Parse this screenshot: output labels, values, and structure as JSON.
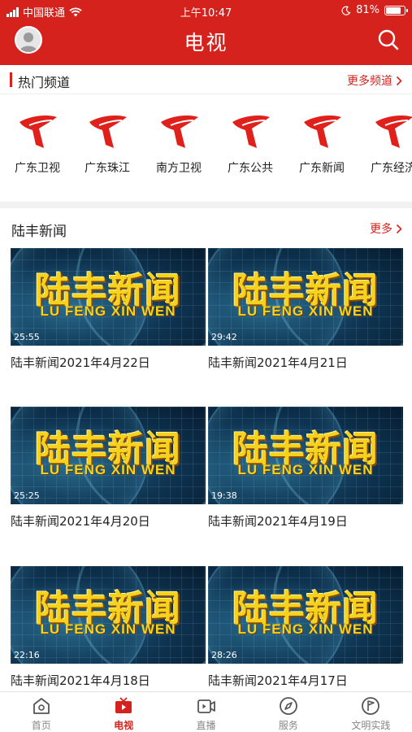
{
  "status": {
    "carrier": "中国联通",
    "time": "上午10:47",
    "battery": "81%",
    "battery_level": 0.81
  },
  "header": {
    "title": "电视",
    "avatar_icon": "user-avatar-icon",
    "search_icon": "search-icon"
  },
  "hot_channels": {
    "title": "热门频道",
    "more": "更多频道",
    "items": [
      {
        "name": "广东卫视"
      },
      {
        "name": "广东珠江"
      },
      {
        "name": "南方卫视"
      },
      {
        "name": "广东公共"
      },
      {
        "name": "广东新闻"
      },
      {
        "name": "广东经济"
      }
    ]
  },
  "news": {
    "title": "陆丰新闻",
    "more": "更多",
    "thumb_cn": "陆丰新闻",
    "thumb_en": "LU FENG XIN WEN",
    "items": [
      {
        "duration": "25:55",
        "title": "陆丰新闻2021年4月22日"
      },
      {
        "duration": "29:42",
        "title": "陆丰新闻2021年4月21日"
      },
      {
        "duration": "25:25",
        "title": "陆丰新闻2021年4月20日"
      },
      {
        "duration": "19:38",
        "title": "陆丰新闻2021年4月19日"
      },
      {
        "duration": "22:16",
        "title": "陆丰新闻2021年4月18日"
      },
      {
        "duration": "28:26",
        "title": "陆丰新闻2021年4月17日"
      }
    ]
  },
  "tabbar": {
    "items": [
      {
        "label": "首页",
        "icon": "home-icon"
      },
      {
        "label": "电视",
        "icon": "tv-icon"
      },
      {
        "label": "直播",
        "icon": "live-video-icon"
      },
      {
        "label": "服务",
        "icon": "compass-icon"
      },
      {
        "label": "文明实践",
        "icon": "flag-badge-icon"
      }
    ]
  },
  "colors": {
    "brand_red": "#d5221d",
    "thumb_yellow": "#f5d21c",
    "tab_inactive": "#888888"
  }
}
